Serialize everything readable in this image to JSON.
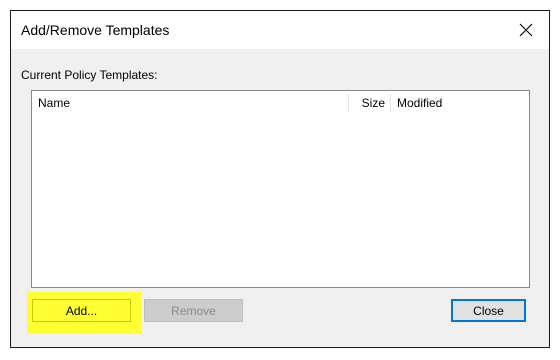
{
  "dialog": {
    "title": "Add/Remove Templates",
    "section_label": "Current Policy Templates:"
  },
  "list": {
    "columns": [
      {
        "label": "Name"
      },
      {
        "label": "Size"
      },
      {
        "label": "Modified"
      }
    ],
    "rows": []
  },
  "buttons": {
    "add": "Add...",
    "remove": "Remove",
    "close": "Close"
  },
  "icons": {
    "close": "close-icon"
  },
  "colors": {
    "highlight": "#ffff33",
    "focus_border": "#0078d7",
    "dialog_bg": "#f0f0f0"
  }
}
